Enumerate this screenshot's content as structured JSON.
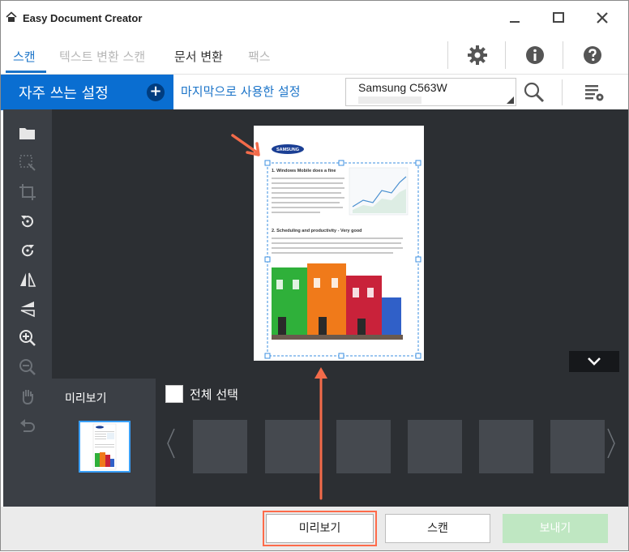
{
  "window": {
    "title": "Easy Document Creator"
  },
  "tabs": [
    {
      "label": "스캔",
      "active": true
    },
    {
      "label": "텍스트 변환 스캔",
      "active": false
    },
    {
      "label": "문서 변환",
      "active": false
    },
    {
      "label": "팩스",
      "active": false
    }
  ],
  "toolbar_icons": [
    "gear-icon",
    "info-icon",
    "help-icon"
  ],
  "presets": {
    "frequent_label": "자주 쓰는 설정",
    "add_symbol": "+",
    "last_used_label": "마지막으로 사용한 설정"
  },
  "printer": {
    "name": "Samsung C563W"
  },
  "left_tools": [
    "open-folder-icon",
    "select-area-icon",
    "crop-icon",
    "rotate-left-icon",
    "rotate-right-icon",
    "flip-horizontal-icon",
    "flip-vertical-icon",
    "zoom-in-icon",
    "zoom-out-icon",
    "pan-hand-icon",
    "undo-icon"
  ],
  "document": {
    "brand": "SAMSUNG",
    "heading1": "1. Windows Mobile does a fine",
    "heading2": "2. Scheduling and productivity - Very good"
  },
  "preview_panel": {
    "label": "미리보기"
  },
  "strip": {
    "select_all_label": "전체 선택"
  },
  "buttons": {
    "preview": "미리보기",
    "scan": "스캔",
    "send": "보내기"
  },
  "colors": {
    "accent_blue": "#0a6ed1",
    "link_blue": "#1a73c8",
    "highlight": "#ff6b4a",
    "send_disabled": "#bfe7c2"
  }
}
